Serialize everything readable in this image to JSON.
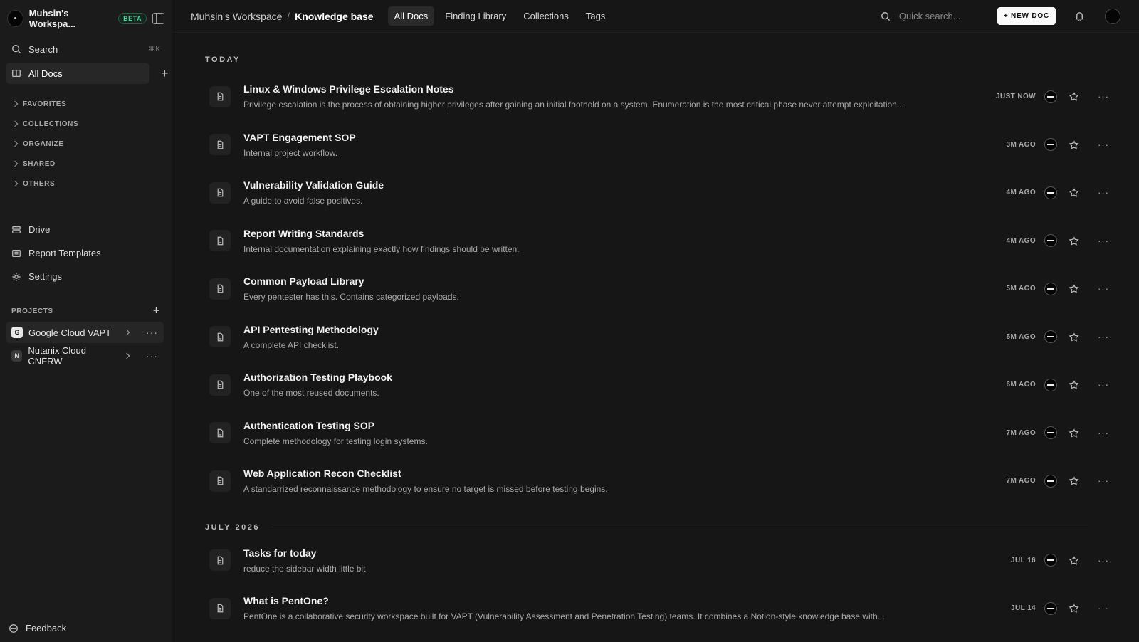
{
  "workspace": {
    "name": "Muhsin's Workspa...",
    "badge": "BETA"
  },
  "sidebar": {
    "search_label": "Search",
    "search_shortcut": "⌘K",
    "all_docs_label": "All Docs",
    "sections": [
      "FAVORITES",
      "COLLECTIONS",
      "ORGANIZE",
      "SHARED",
      "OTHERS"
    ],
    "nav": [
      {
        "label": "Drive",
        "icon": "drive-icon"
      },
      {
        "label": "Report Templates",
        "icon": "templates-icon"
      },
      {
        "label": "Settings",
        "icon": "gear-icon"
      }
    ],
    "projects_title": "PROJECTS",
    "projects": [
      {
        "badge": "G",
        "label": "Google Cloud VAPT",
        "active": true
      },
      {
        "badge": "N",
        "label": "Nutanix Cloud CNFRW",
        "active": false
      }
    ],
    "feedback_label": "Feedback"
  },
  "topbar": {
    "breadcrumb_root": "Muhsin's Workspace",
    "breadcrumb_sep": "/",
    "breadcrumb_current": "Knowledge base",
    "tabs": [
      {
        "label": "All Docs",
        "active": true
      },
      {
        "label": "Finding Library",
        "active": false
      },
      {
        "label": "Collections",
        "active": false
      },
      {
        "label": "Tags",
        "active": false
      }
    ],
    "search_placeholder": "Quick search...",
    "new_doc_label": "+ NEW DOC"
  },
  "groups": [
    {
      "title": "TODAY",
      "docs": [
        {
          "title": "Linux & Windows Privilege Escalation Notes",
          "desc": "Privilege escalation is the process of obtaining higher privileges after gaining an initial foothold on a system. Enumeration is the most critical phase never attempt exploitation...",
          "time": "JUST NOW"
        },
        {
          "title": "VAPT Engagement SOP",
          "desc": "Internal project workflow.",
          "time": "3M AGO"
        },
        {
          "title": "Vulnerability Validation Guide",
          "desc": "A guide to avoid false positives.",
          "time": "4M AGO"
        },
        {
          "title": "Report Writing Standards",
          "desc": "Internal documentation explaining exactly how findings should be written.",
          "time": "4M AGO"
        },
        {
          "title": "Common Payload Library",
          "desc": "Every pentester has this. Contains categorized payloads.",
          "time": "5M AGO"
        },
        {
          "title": "API Pentesting Methodology",
          "desc": "A complete API checklist.",
          "time": "5M AGO"
        },
        {
          "title": "Authorization Testing Playbook",
          "desc": "One of the most reused documents.",
          "time": "6M AGO"
        },
        {
          "title": "Authentication Testing SOP",
          "desc": "Complete methodology for testing login systems.",
          "time": "7M AGO"
        },
        {
          "title": "Web Application Recon Checklist",
          "desc": "A standarrized reconnaissance methodology to ensure no target is missed before testing begins.",
          "time": "7M AGO"
        }
      ]
    },
    {
      "title": "JULY 2026",
      "docs": [
        {
          "title": "Tasks for today",
          "desc": "reduce the sidebar width little bit",
          "time": "JUL 16"
        },
        {
          "title": "What is PentOne?",
          "desc": "PentOne is a collaborative security workspace built for VAPT (Vulnerability Assessment and Penetration Testing) teams. It combines a Notion-style knowledge base with...",
          "time": "JUL 14"
        }
      ]
    }
  ]
}
